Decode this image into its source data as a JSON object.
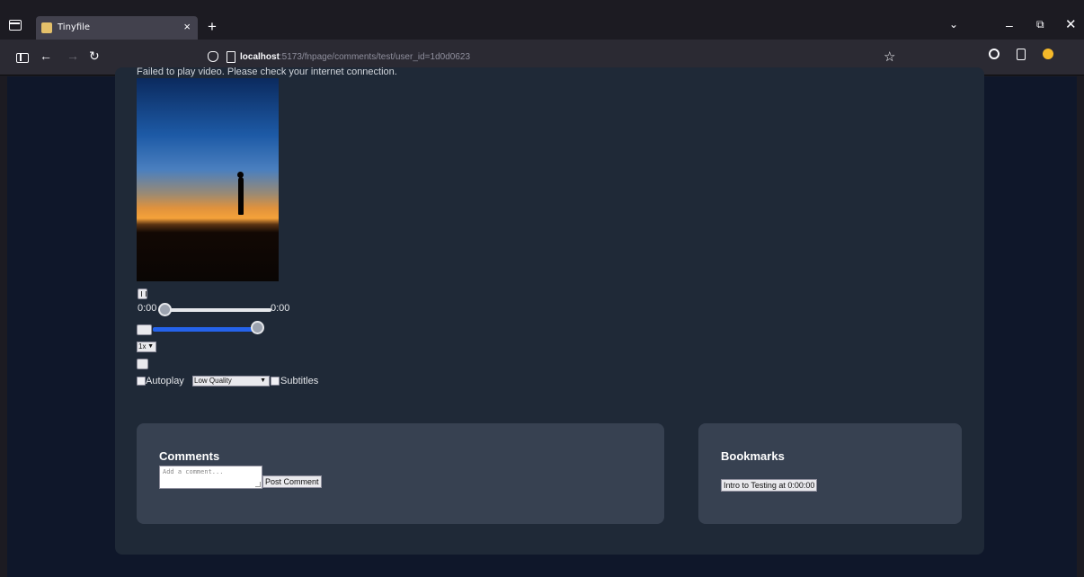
{
  "browser": {
    "tab_title": "Tinyfile",
    "tab_close": "×",
    "new_tab": "+",
    "tabs_menu": "⌄",
    "window": {
      "minimize": "–",
      "maximize": "⧉",
      "close": "✕"
    },
    "nav": {
      "back": "←",
      "forward": "→",
      "reload": "↻"
    },
    "url_host": "localhost",
    "url_path": ":5173/fnpage/comments/test/user_id=1d0d0623",
    "bookmark_star": "☆",
    "menu": "≡"
  },
  "video": {
    "error_message": "Failed to play video. Please check your internet connection.",
    "current_time": "0:00",
    "duration": "0:00",
    "seek_progress": 0.0,
    "volume": 1.0,
    "speed": "1x",
    "autoplay_label": "Autoplay",
    "autoplay_checked": false,
    "quality": "Low Quality",
    "subtitles_label": "Subtitles",
    "subtitles_checked": false
  },
  "comments": {
    "title": "Comments",
    "placeholder": "Add a comment...",
    "post_label": "Post Comment"
  },
  "bookmarks": {
    "title": "Bookmarks",
    "items": [
      "Intro to Testing at 0:00:00"
    ]
  },
  "icons": [
    "tab-list-icon",
    "shield-icon",
    "page-icon",
    "star-icon",
    "extension-icon",
    "account-icon",
    "play-pause-icon",
    "mute-icon",
    "fullscreen-icon"
  ]
}
